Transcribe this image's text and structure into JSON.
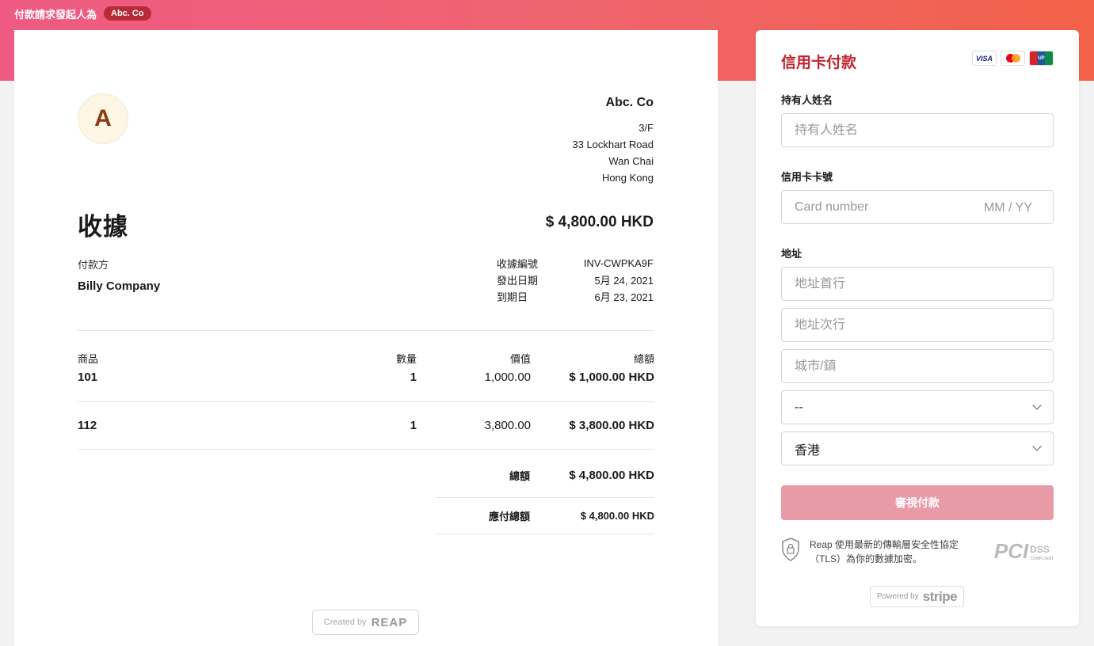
{
  "topbar": {
    "label": "付款請求發起人為",
    "merchant": "Abc. Co"
  },
  "receipt": {
    "avatar_letter": "A",
    "issuer": {
      "name": "Abc. Co",
      "address": [
        "3/F",
        "33 Lockhart Road",
        "Wan Chai",
        "Hong Kong"
      ]
    },
    "title": "收據",
    "amount": "$ 4,800.00 HKD",
    "payer_label": "付款方",
    "payer_name": "Billy Company",
    "meta": [
      {
        "label": "收據編號",
        "value": "INV-CWPKA9F"
      },
      {
        "label": "發出日期",
        "value": "5月 24, 2021"
      },
      {
        "label": "到期日",
        "value": "6月 23, 2021"
      }
    ],
    "columns": [
      "商品",
      "數量",
      "價值",
      "總額"
    ],
    "items": [
      {
        "name": "101",
        "qty": "1",
        "price": "1,000.00",
        "total": "$ 1,000.00 HKD"
      },
      {
        "name": "112",
        "qty": "1",
        "price": "3,800.00",
        "total": "$ 3,800.00 HKD"
      }
    ],
    "totals": [
      {
        "label": "總額",
        "value": "$ 4,800.00 HKD"
      },
      {
        "label": "應付總額",
        "value": "$ 4,800.00 HKD"
      }
    ],
    "created_by": {
      "prefix": "Created by",
      "brand": "REAP"
    }
  },
  "payment": {
    "title": "信用卡付款",
    "card_brands": [
      "VISA",
      "mastercard",
      "UnionPay"
    ],
    "holder_label": "持有人姓名",
    "holder_placeholder": "持有人姓名",
    "card_label": "信用卡卡號",
    "card_placeholder": "Card number",
    "expiry_placeholder": "MM / YY",
    "address_label": "地址",
    "address1_placeholder": "地址首行",
    "address2_placeholder": "地址次行",
    "city_placeholder": "城市/鎮",
    "region_value": "--",
    "country_value": "香港",
    "review_button": "審視付款",
    "security_text": "Reap 使用最新的傳輸層安全性協定（TLS）為你的數據加密。",
    "pci": {
      "big": "PCI",
      "dss": "DSS",
      "compliant": "COMPLIANT"
    },
    "powered": {
      "prefix": "Powered by",
      "brand": "stripe"
    }
  }
}
